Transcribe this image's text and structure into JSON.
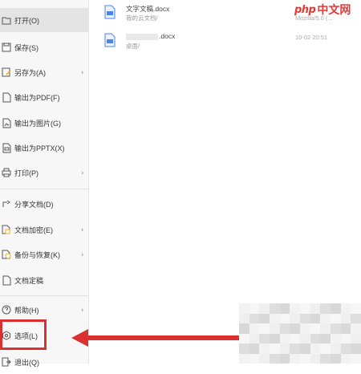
{
  "menu": {
    "items": [
      {
        "label": "打开(O)",
        "icon": "folder-open-icon",
        "arrow": false,
        "active": true
      },
      {
        "label": "保存(S)",
        "icon": "save-icon",
        "arrow": false
      },
      {
        "label": "另存为(A)",
        "icon": "save-as-icon",
        "arrow": true
      },
      {
        "label": "输出为PDF(F)",
        "icon": "pdf-icon",
        "arrow": false
      },
      {
        "label": "输出为图片(G)",
        "icon": "image-icon",
        "arrow": false
      },
      {
        "label": "输出为PPTX(X)",
        "icon": "pptx-icon",
        "arrow": false
      },
      {
        "label": "打印(P)",
        "icon": "print-icon",
        "arrow": true
      },
      {
        "label": "分享文档(D)",
        "icon": "share-icon",
        "arrow": false
      },
      {
        "label": "文档加密(E)",
        "icon": "lock-icon",
        "arrow": true
      },
      {
        "label": "备份与恢复(K)",
        "icon": "backup-icon",
        "arrow": true
      },
      {
        "label": "文档定稿",
        "icon": "finalize-icon",
        "arrow": false
      },
      {
        "label": "帮助(H)",
        "icon": "help-icon",
        "arrow": true
      },
      {
        "label": "选项(L)",
        "icon": "options-icon",
        "arrow": false
      },
      {
        "label": "退出(Q)",
        "icon": "exit-icon",
        "arrow": false
      }
    ],
    "arrow_glyph": "›"
  },
  "recent_files": [
    {
      "name": "文字文稿.docx",
      "path": "我的云文档/",
      "meta": "Mozilla/5.0 (..."
    },
    {
      "name": ".docx",
      "path": "桌面/",
      "meta": "10-02 20:51"
    }
  ],
  "watermark": {
    "php": "php",
    "cn": "中文网"
  },
  "colors": {
    "annotation": "#d9312f",
    "menu_bg": "#f7f7f7",
    "active_bg": "#e4e4e4"
  }
}
